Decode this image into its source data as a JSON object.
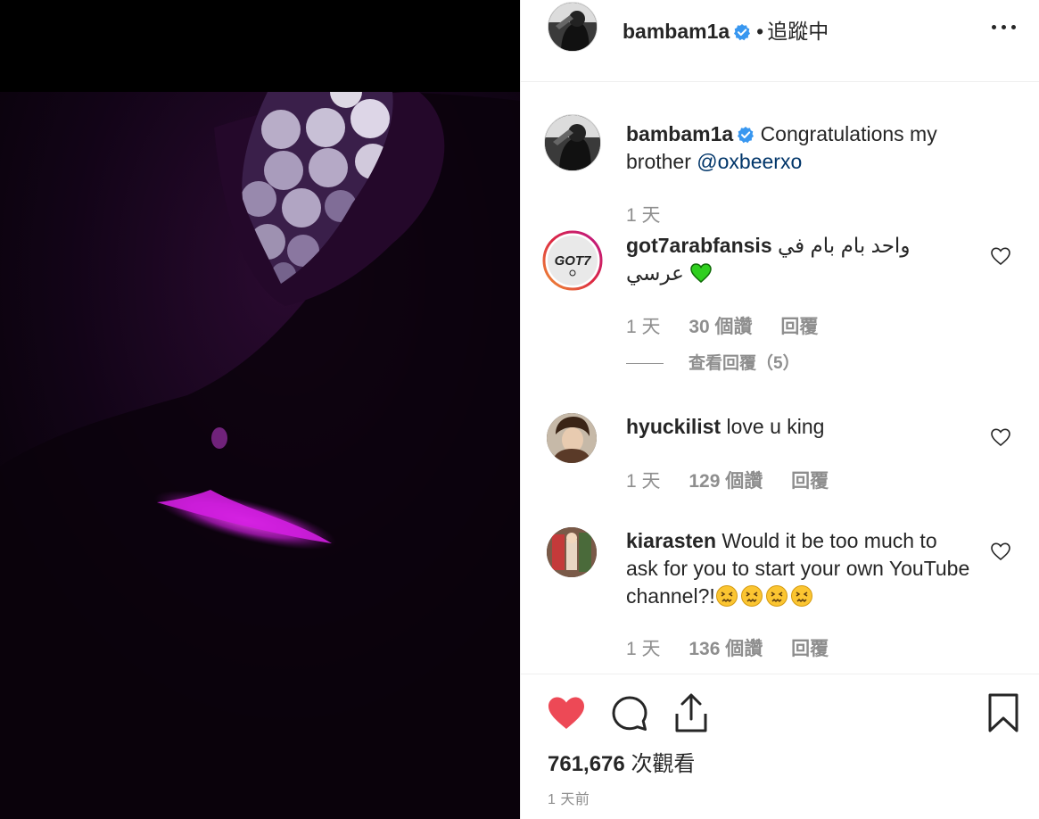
{
  "post": {
    "author": "bambam1a",
    "follow_status": "追蹤中",
    "caption_text": "Congratulations my brother",
    "caption_mention": "@oxbeerxo",
    "caption_time": "1 天"
  },
  "comments": [
    {
      "username": "got7arabfansis",
      "text": "واحد بام بام في عرسي",
      "avatar_logo_text": "GOT7",
      "time": "1 天",
      "likes": "30 個讚",
      "reply": "回覆",
      "view_replies": "查看回覆（5）"
    },
    {
      "username": "hyuckilist",
      "text": "love u king",
      "time": "1 天",
      "likes": "129 個讚",
      "reply": "回覆"
    },
    {
      "username": "kiarasten",
      "text": "Would it be too much to ask for you to start your own YouTube channel?!",
      "time": "1 天",
      "likes": "136 個讚",
      "reply": "回覆"
    }
  ],
  "stats": {
    "views_number": "761,676",
    "views_label": "次觀看",
    "posted": "1 天前"
  },
  "icons": {
    "liked_heart": "heart-filled-icon",
    "comment": "comment-bubble-icon",
    "share": "share-icon",
    "save": "bookmark-icon",
    "verified": "verified-badge-icon",
    "more": "more-options-icon"
  },
  "colors": {
    "like_red": "#ed4956",
    "verified_blue": "#3897f0",
    "mention_blue": "#003569",
    "muted_gray": "#8e8e8e",
    "lightstick_magenta": "#d21ee0"
  }
}
